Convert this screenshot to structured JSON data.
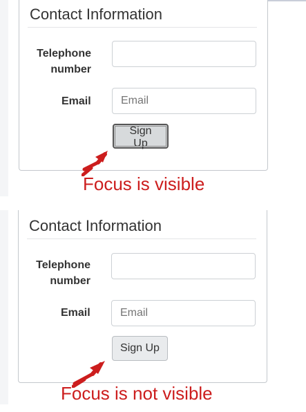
{
  "examples": [
    {
      "legend": "Contact Information",
      "telephone_label": "Telephone number",
      "email_label": "Email",
      "email_placeholder": "Email",
      "telephone_value": "",
      "button_label": "Sign Up",
      "button_focused": true,
      "caption": "Focus is visible"
    },
    {
      "legend": "Contact Information",
      "telephone_label": "Telephone number",
      "email_label": "Email",
      "email_placeholder": "Email",
      "telephone_value": "",
      "button_label": "Sign Up",
      "button_focused": false,
      "caption": "Focus is not visible"
    }
  ],
  "colors": {
    "caption": "#cc1d1d",
    "arrow": "#cc1d1d",
    "border": "#c3c7cc",
    "focus_ring": "#555555"
  },
  "icons": [
    "arrow-pointer-icon"
  ]
}
